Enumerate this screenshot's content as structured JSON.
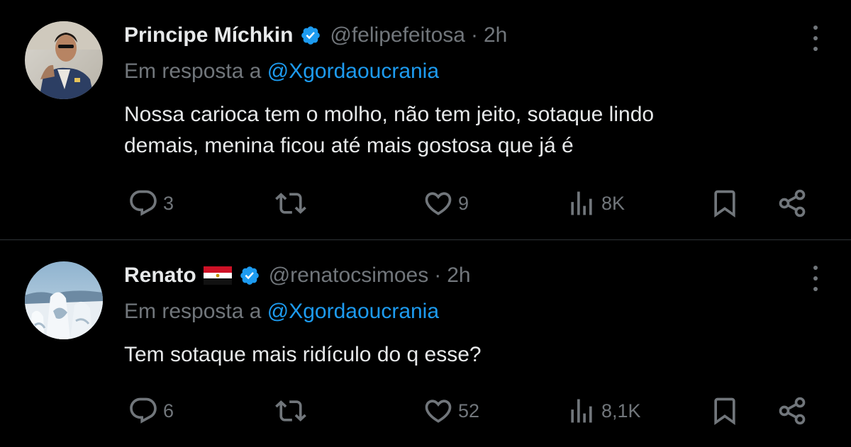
{
  "tweets": [
    {
      "display_name": "Principe Míchkin",
      "handle": "@felipefeitosa",
      "separator": "·",
      "time": "2h",
      "reply_prefix": "Em resposta a",
      "reply_to": "@Xgordaoucrania",
      "text_lines": [
        "Nossa carioca tem o molho, não tem jeito, sotaque lindo",
        "demais, menina ficou até mais gostosa que já é"
      ],
      "counts": {
        "replies": "3",
        "likes": "9",
        "views": "8K"
      }
    },
    {
      "display_name": "Renato",
      "flag": "egypt-flag",
      "handle": "@renatocsimoes",
      "separator": "·",
      "time": "2h",
      "reply_prefix": "Em resposta a",
      "reply_to": "@Xgordaoucrania",
      "text_lines": [
        "Tem sotaque mais ridículo do q esse?"
      ],
      "counts": {
        "replies": "6",
        "likes": "52",
        "views": "8,1K"
      }
    }
  ],
  "icons": {
    "reply": "reply-icon",
    "retweet": "retweet-icon",
    "like": "heart-icon",
    "views": "views-icon",
    "bookmark": "bookmark-icon",
    "share": "share-icon",
    "verified": "verified-badge-icon",
    "more": "more-options-icon"
  },
  "colors": {
    "background": "#000000",
    "text": "#e7e9ea",
    "muted": "#71767b",
    "link": "#1d9bf0",
    "divider": "#2f3336"
  }
}
